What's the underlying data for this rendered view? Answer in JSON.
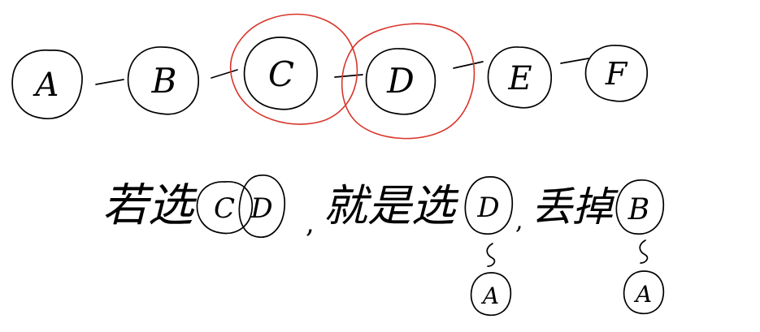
{
  "colors": {
    "ink": "#000000",
    "highlight": "#d9352b",
    "background": "#ffffff"
  },
  "chain_nodes": [
    "A",
    "B",
    "C",
    "D",
    "E",
    "F"
  ],
  "highlighted_nodes": [
    "C",
    "D"
  ],
  "sentence": {
    "part1": "若选",
    "pair_left": "C",
    "pair_right": "D",
    "comma": ",",
    "part2": "就是选",
    "chosen": "D",
    "comma2": ",",
    "part3": "丢掉",
    "dropped": "B"
  },
  "annotations": [
    {
      "target": "D",
      "label": "A"
    },
    {
      "target": "B",
      "label": "A"
    }
  ]
}
